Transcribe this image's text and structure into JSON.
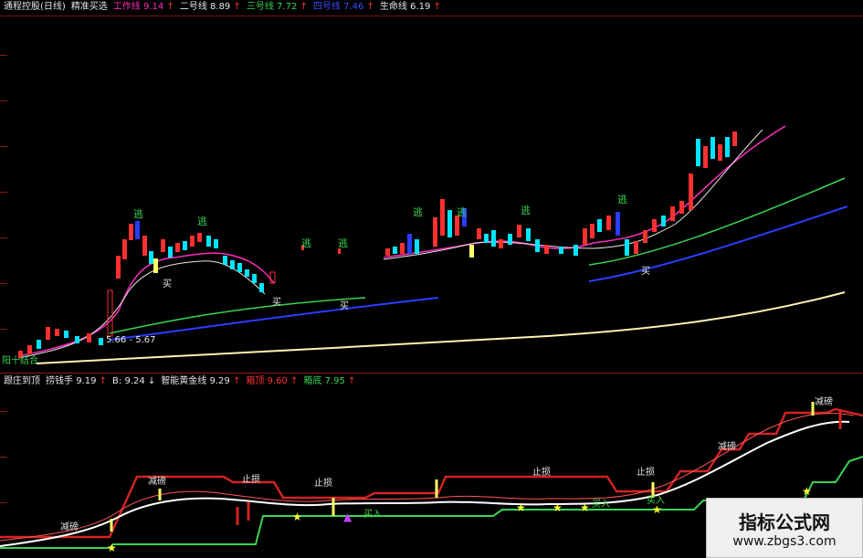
{
  "top_legend": {
    "title": "通程控股(日线)",
    "indicator": "精准买选",
    "items": [
      {
        "label": "工作线",
        "value": "9.14",
        "arrow": "↑",
        "color": "#ff2fbf"
      },
      {
        "label": "二号线",
        "value": "8.89",
        "arrow": "↑",
        "color": "#e6e6e6"
      },
      {
        "label": "三号线",
        "value": "7.72",
        "arrow": "↑",
        "color": "#39d353"
      },
      {
        "label": "四号线",
        "value": "7.46",
        "arrow": "↑",
        "color": "#3b4cff"
      },
      {
        "label": "生命线",
        "value": "6.19",
        "arrow": "↑",
        "color": "#e6e6e6"
      }
    ]
  },
  "bottom_legend": {
    "title": "跟庄到顶",
    "items": [
      {
        "label": "捞钱手",
        "value": "9.19",
        "arrow": "↑",
        "color": "#e6e6e6"
      },
      {
        "label": "B",
        "value": "9.24",
        "arrow": "↓",
        "color": "#e6e6e6"
      },
      {
        "label": "智能黄金线",
        "value": "9.29",
        "arrow": "↑",
        "color": "#e6e6e6"
      },
      {
        "label": "箱顶",
        "value": "9.60",
        "arrow": "↑",
        "color": "#ff3333"
      },
      {
        "label": "箱底",
        "value": "7.95",
        "arrow": "↑",
        "color": "#39d353"
      }
    ]
  },
  "upper_chart": {
    "escape_labels": [
      "逃",
      "逃",
      "逃",
      "逃",
      "逃",
      "逃",
      "逃",
      "逃"
    ],
    "buy_labels": [
      "买",
      "买",
      "买",
      "买"
    ],
    "price_range_label": "5.66 - 5.67",
    "corner_label": "阳十结合"
  },
  "lower_chart": {
    "reduce_labels": [
      "减磅",
      "减磅",
      "减磅",
      "减磅"
    ],
    "stop_labels": [
      "止损",
      "止损",
      "止损",
      "止损"
    ],
    "buy_in_labels": [
      "买入",
      "买入",
      "买入"
    ]
  },
  "watermark": {
    "title": "指标公式网",
    "url": "www.zbgs3.com"
  },
  "colors": {
    "background": "#000000",
    "grid": "#7a0f0f",
    "up": "#ff3030",
    "down": "#00e5ff",
    "work_line": "#ff2fbf",
    "life_line": "#fff2b3"
  }
}
